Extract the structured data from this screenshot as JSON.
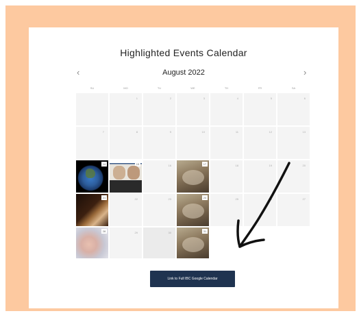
{
  "title": "Highlighted Events Calendar",
  "month_label": "August 2022",
  "nav": {
    "prev_icon": "‹",
    "next_icon": "›"
  },
  "weekdays": [
    "SU",
    "MO",
    "TU",
    "WE",
    "TH",
    "FR",
    "SA"
  ],
  "weeks": [
    [
      {
        "day": ""
      },
      {
        "day": "1"
      },
      {
        "day": "2"
      },
      {
        "day": "3"
      },
      {
        "day": "4"
      },
      {
        "day": "5"
      },
      {
        "day": "6"
      }
    ],
    [
      {
        "day": "7"
      },
      {
        "day": "8"
      },
      {
        "day": "9"
      },
      {
        "day": "10"
      },
      {
        "day": "11"
      },
      {
        "day": "12"
      },
      {
        "day": "13"
      }
    ],
    [
      {
        "day": "14",
        "image": "earth"
      },
      {
        "day": "15",
        "image": "zoom"
      },
      {
        "day": "16"
      },
      {
        "day": "17",
        "image": "meet"
      },
      {
        "day": "18"
      },
      {
        "day": "19"
      },
      {
        "day": "20"
      }
    ],
    [
      {
        "day": "21",
        "image": "bible"
      },
      {
        "day": "22"
      },
      {
        "day": "23"
      },
      {
        "day": "24",
        "image": "meet"
      },
      {
        "day": "25"
      },
      {
        "day": "26"
      },
      {
        "day": "27"
      }
    ],
    [
      {
        "day": "28",
        "image": "baby"
      },
      {
        "day": "29"
      },
      {
        "day": "30",
        "muted": true
      },
      {
        "day": "31",
        "image": "meet"
      },
      {
        "day": "",
        "blank": true
      },
      {
        "day": "",
        "blank": true
      },
      {
        "day": "",
        "blank": true
      }
    ]
  ],
  "link_button_label": "Link to Full IBC Google Calendar",
  "colors": {
    "frame": "#fdc9a0",
    "button": "#1f3350",
    "cell": "#f4f4f4",
    "arrow": "#111111"
  }
}
